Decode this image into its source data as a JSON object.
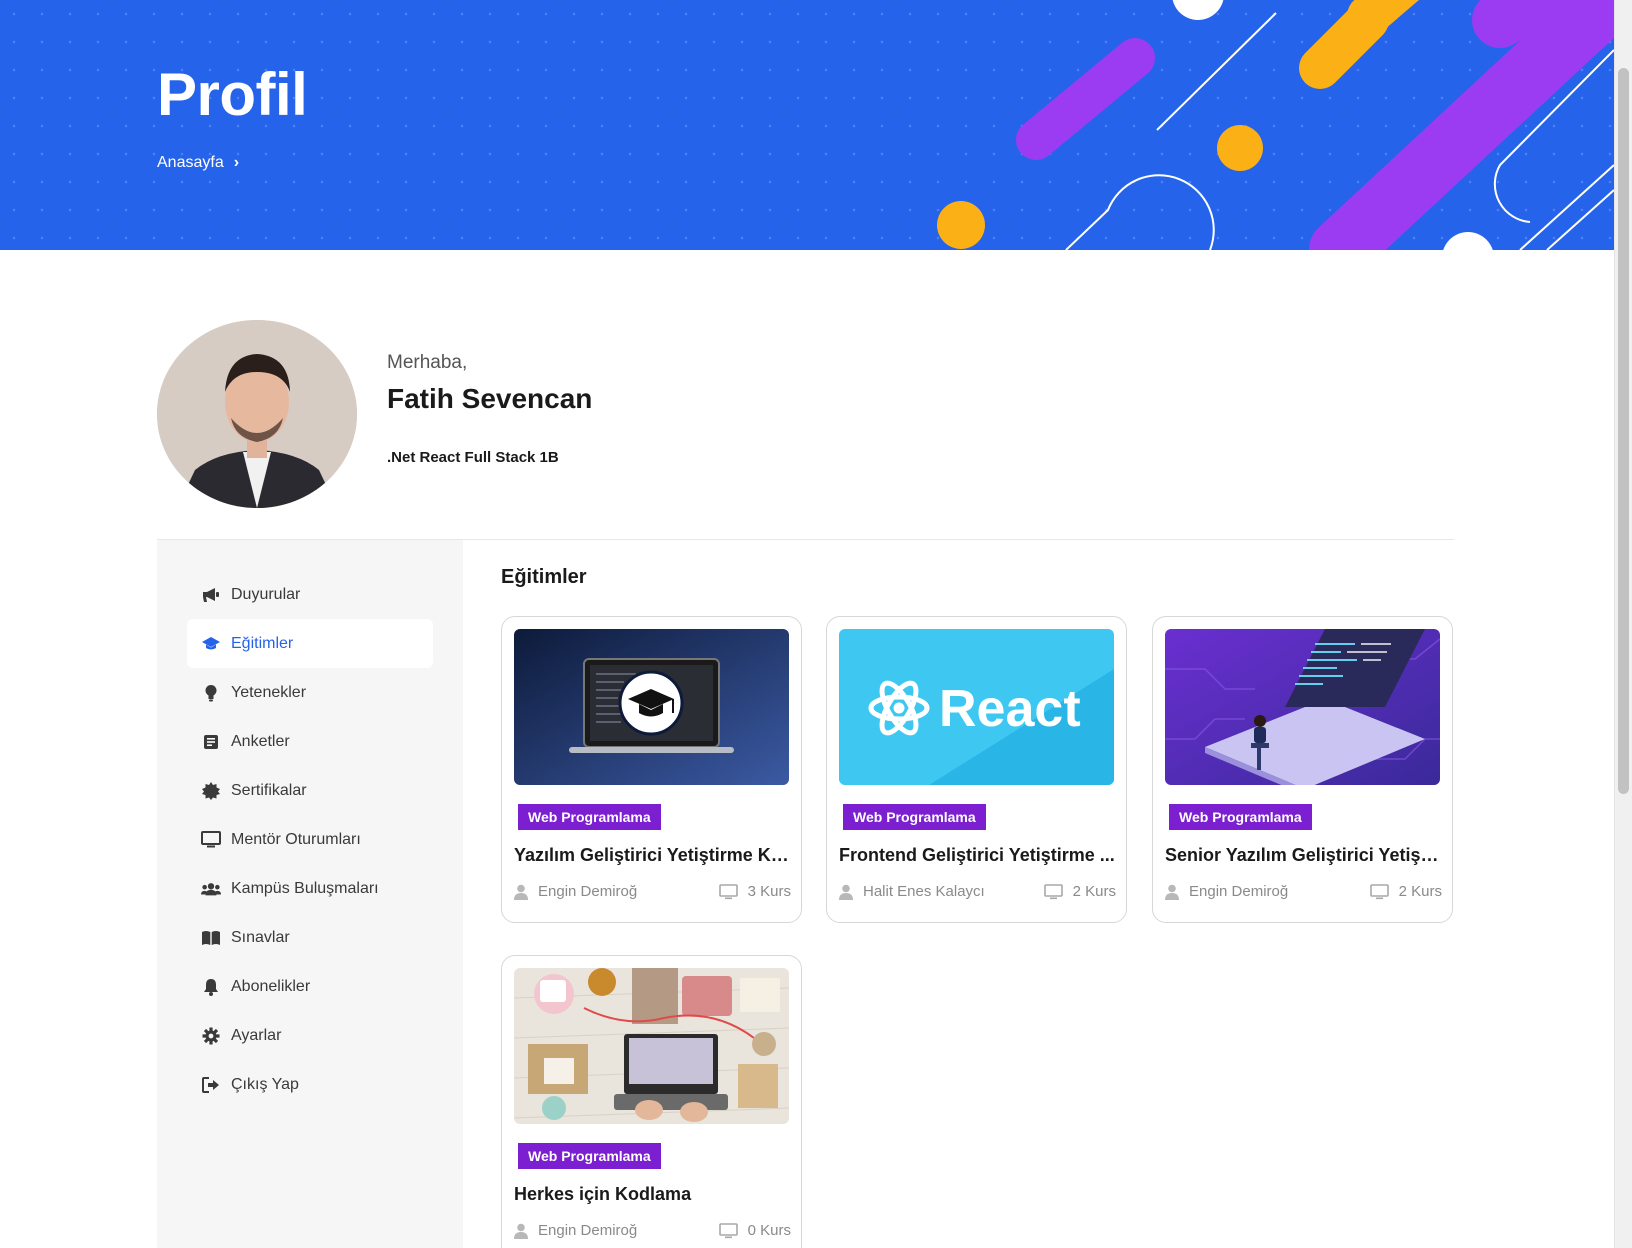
{
  "header": {
    "title": "Profil",
    "breadcrumb": [
      "Anasayfa"
    ]
  },
  "profile": {
    "greeting": "Merhaba,",
    "name": "Fatih Sevencan",
    "class_name": ".Net React Full Stack 1B"
  },
  "sidebar": {
    "items": [
      {
        "label": "Duyurular",
        "icon": "megaphone-icon"
      },
      {
        "label": "Eğitimler",
        "icon": "graduation-cap-icon",
        "active": true
      },
      {
        "label": "Yetenekler",
        "icon": "lightbulb-icon"
      },
      {
        "label": "Anketler",
        "icon": "survey-icon"
      },
      {
        "label": "Sertifikalar",
        "icon": "certificate-icon"
      },
      {
        "label": "Mentör Oturumları",
        "icon": "monitor-icon"
      },
      {
        "label": "Kampüs Buluşmaları",
        "icon": "users-icon"
      },
      {
        "label": "Sınavlar",
        "icon": "book-icon"
      },
      {
        "label": "Abonelikler",
        "icon": "bell-icon"
      },
      {
        "label": "Ayarlar",
        "icon": "gear-icon"
      },
      {
        "label": "Çıkış Yap",
        "icon": "logout-icon"
      }
    ]
  },
  "content": {
    "section_title": "Eğitimler",
    "courses": [
      {
        "category": "Web Programlama",
        "title": "Yazılım Geliştirici Yetiştirme Ka...",
        "instructor": "Engin Demiroğ",
        "count": "3 Kurs",
        "image": "laptop-graduation-cap"
      },
      {
        "category": "Web Programlama",
        "title": "Frontend Geliştirici Yetiştirme ...",
        "instructor": "Halit Enes Kalaycı",
        "count": "2 Kurs",
        "image": "react-logo",
        "image_text": "React"
      },
      {
        "category": "Web Programlama",
        "title": "Senior Yazılım Geliştirici Yetişti...",
        "instructor": "Engin Demiroğ",
        "count": "2 Kurs",
        "image": "isometric-laptop-developer"
      },
      {
        "category": "Web Programlama",
        "title": "Herkes için Kodlama",
        "instructor": "Engin Demiroğ",
        "count": "0 Kurs",
        "image": "desk-laptop-typing"
      }
    ]
  },
  "colors": {
    "banner": "#2563eb",
    "accent": "#2563eb",
    "badge": "#7c1fd1",
    "purple_shape": "#9b3cf2",
    "yellow_shape": "#fbb116"
  }
}
